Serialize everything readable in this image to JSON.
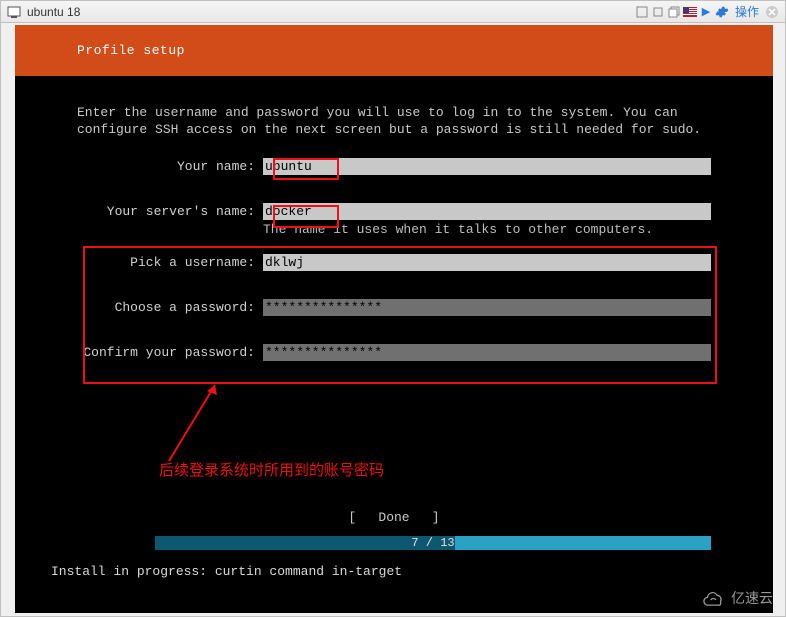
{
  "window": {
    "title": "ubuntu 18",
    "action_label": "操作"
  },
  "header": {
    "title": "Profile setup"
  },
  "instructions": "Enter the username and password you will use to log in to the system. You can configure SSH access on the next screen but a password is still needed for sudo.",
  "fields": {
    "name": {
      "label": "Your name:",
      "value": "ubuntu"
    },
    "server": {
      "label": "Your server's name:",
      "value": "docker",
      "hint": "The name it uses when it talks to other computers."
    },
    "user": {
      "label": "Pick a username:",
      "value": "dklwj"
    },
    "pass": {
      "label": "Choose a password:",
      "value": "***************"
    },
    "confirm": {
      "label": "Confirm your password:",
      "value": "***************"
    }
  },
  "done_button": "Done",
  "progress": {
    "current": 7,
    "total": 13,
    "text": "7 / 13"
  },
  "status": "Install in progress: curtin command in-target",
  "annotation": "后续登录系统时所用到的账号密码",
  "watermark": "亿速云"
}
